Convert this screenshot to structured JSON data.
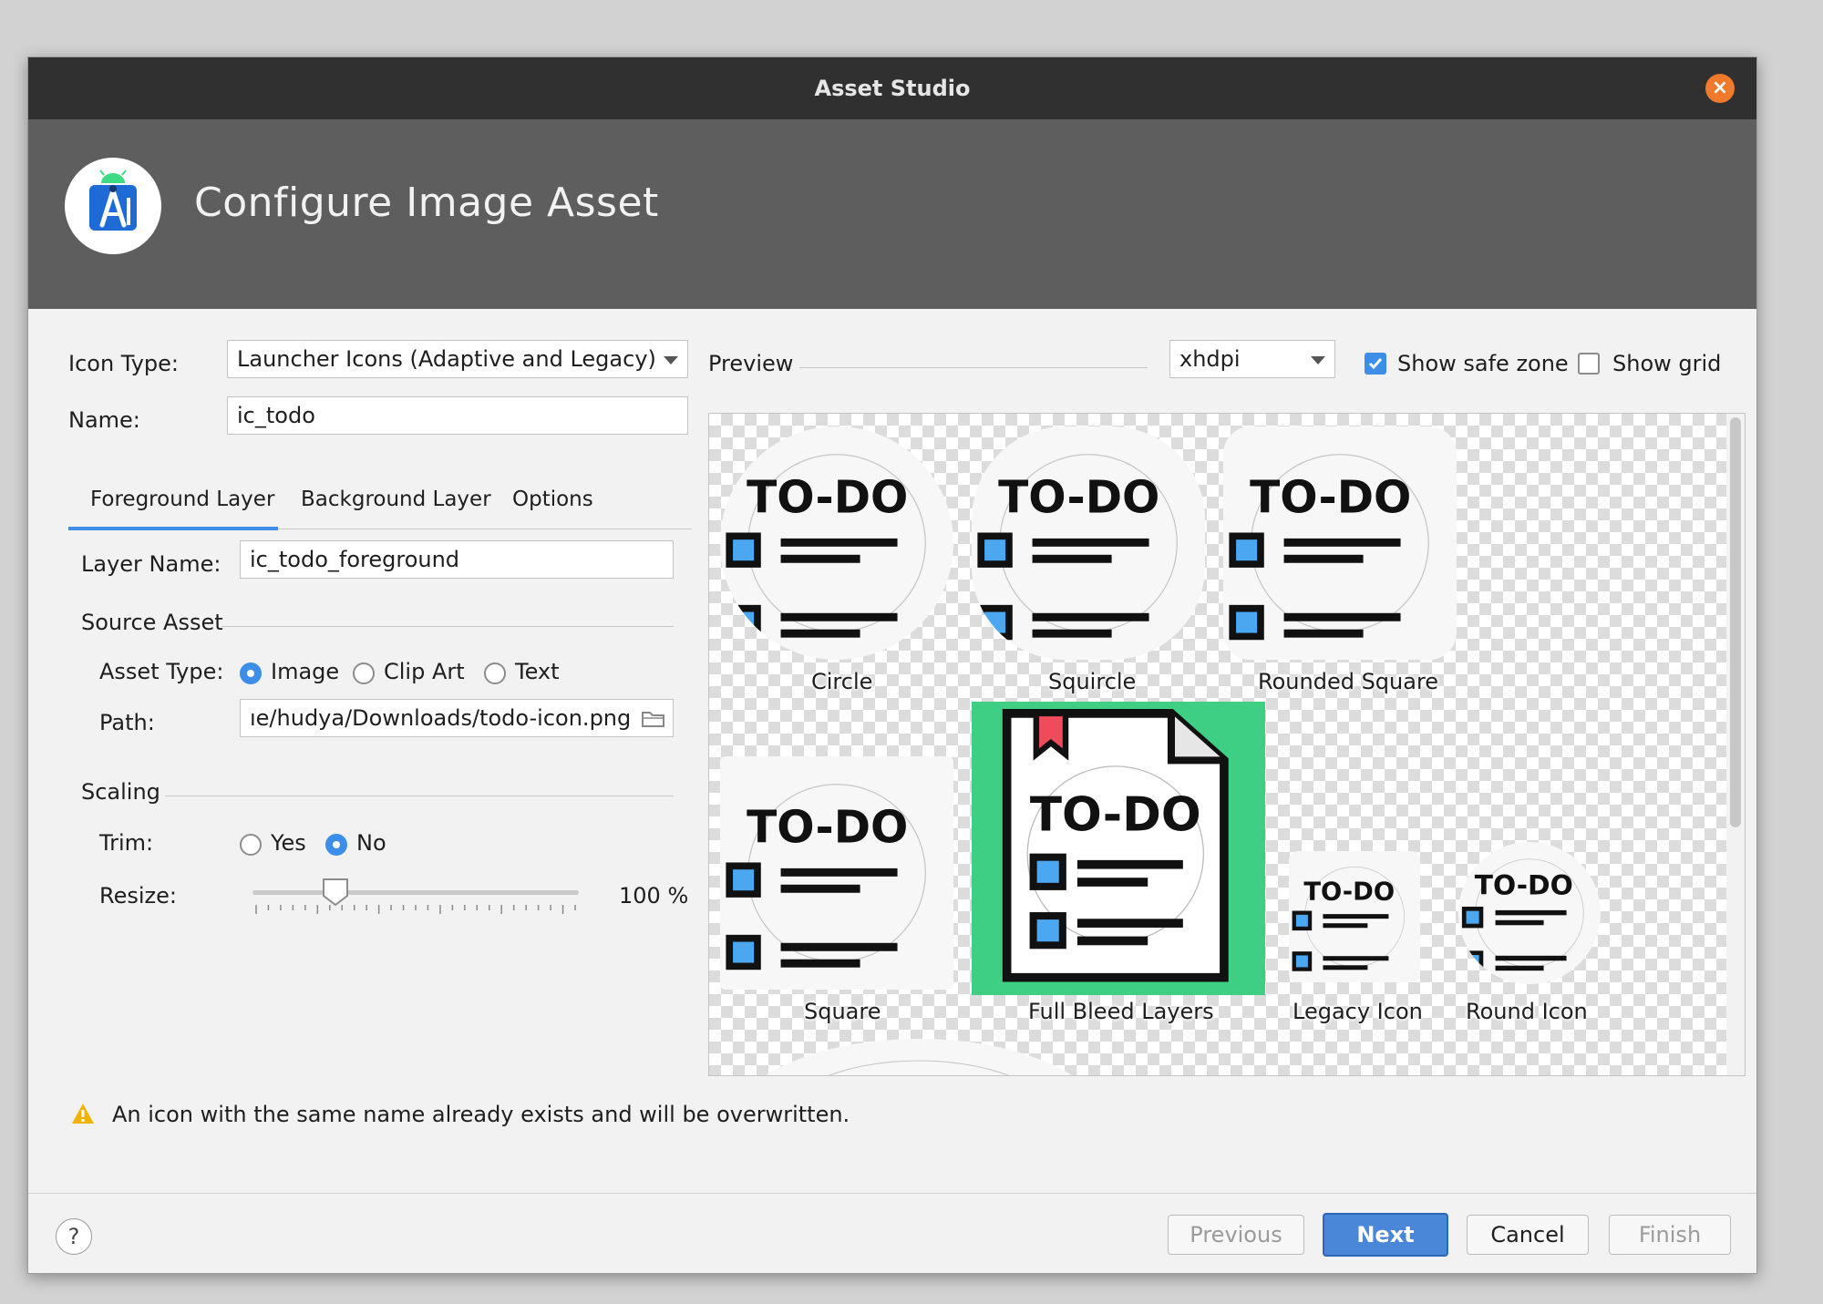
{
  "window": {
    "title": "Asset Studio"
  },
  "header": {
    "title": "Configure Image Asset"
  },
  "form": {
    "icon_type_label": "Icon Type:",
    "icon_type_value": "Launcher Icons (Adaptive and Legacy)",
    "name_label": "Name:",
    "name_value": "ic_todo"
  },
  "tabs": [
    {
      "label": "Foreground Layer",
      "active": true
    },
    {
      "label": "Background Layer",
      "active": false
    },
    {
      "label": "Options",
      "active": false
    }
  ],
  "layer": {
    "name_label": "Layer Name:",
    "name_value": "ic_todo_foreground",
    "source_section": "Source Asset",
    "asset_type_label": "Asset Type:",
    "asset_types": [
      "Image",
      "Clip Art",
      "Text"
    ],
    "asset_type_selected": "Image",
    "path_label": "Path:",
    "path_value": "ıe/hudya/Downloads/todo-icon.png",
    "scaling_section": "Scaling",
    "trim_label": "Trim:",
    "trim_options": [
      "Yes",
      "No"
    ],
    "trim_selected": "No",
    "resize_label": "Resize:",
    "resize_value": "100 %",
    "resize_percent": 100
  },
  "preview": {
    "label": "Preview",
    "density": "xhdpi",
    "show_safe_zone_label": "Show safe zone",
    "show_safe_zone": true,
    "show_grid_label": "Show grid",
    "show_grid": false,
    "icon_text": "TO-DO",
    "captions": {
      "circle": "Circle",
      "squircle": "Squircle",
      "rounded": "Rounded Square",
      "square": "Square",
      "fullbleed": "Full Bleed Layers",
      "legacy": "Legacy Icon",
      "round": "Round Icon"
    }
  },
  "warning": {
    "text": "An icon with the same name already exists and will be overwritten."
  },
  "buttons": {
    "help": "?",
    "previous": "Previous",
    "next": "Next",
    "cancel": "Cancel",
    "finish": "Finish"
  },
  "colors": {
    "accent": "#3d8ee8",
    "full_bleed_bg": "#3ecf84",
    "close_button": "#f07a2c",
    "header_bg": "#5e5e5e",
    "titlebar_bg": "#303030",
    "warning": "#f0b400"
  }
}
